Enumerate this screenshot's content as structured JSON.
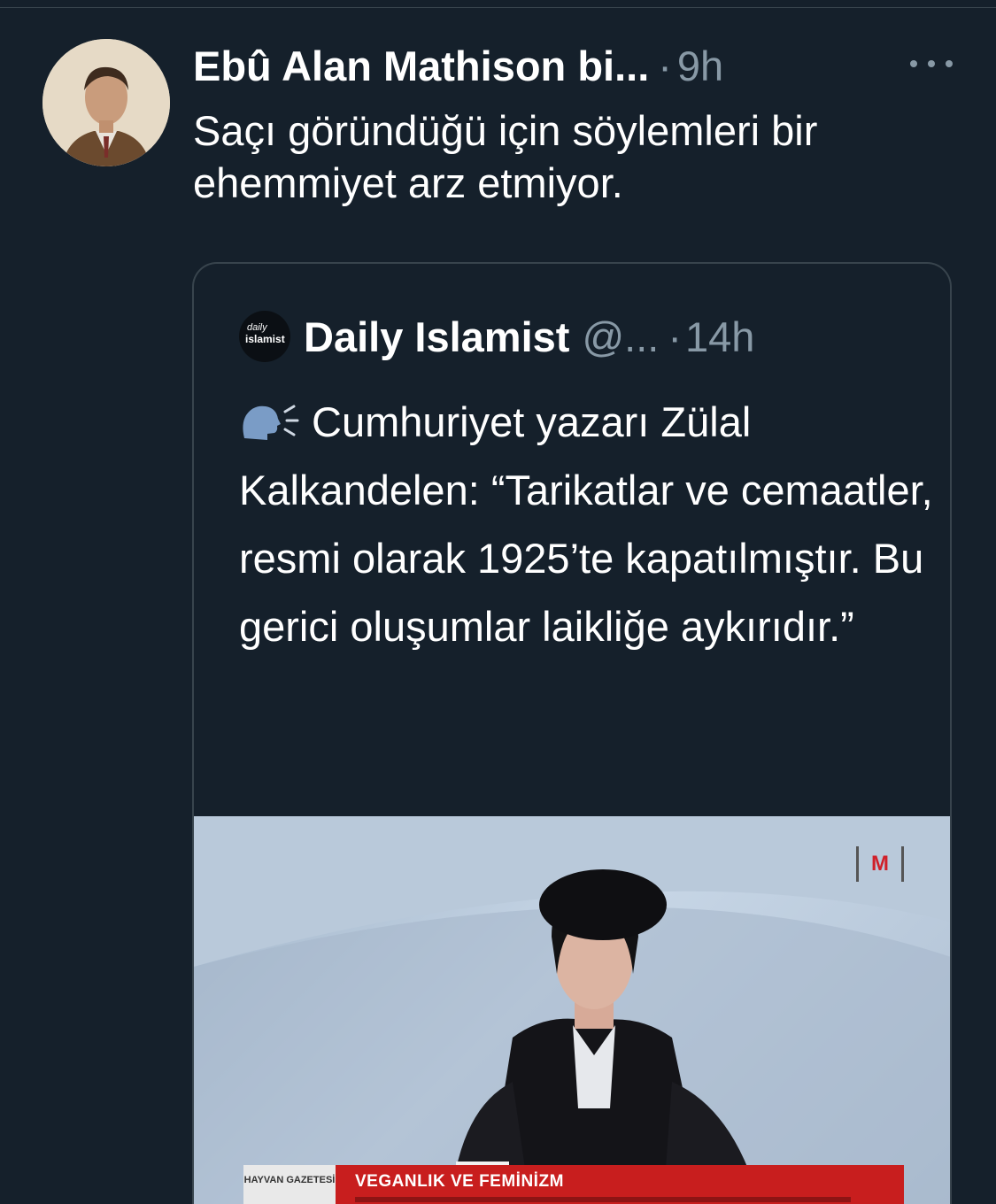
{
  "tweet": {
    "author": "Ebû Alan Mathison bi...",
    "separator": "·",
    "time": "9h",
    "text": "Saçı göründüğü için söylemleri bir ehemmiyet arz etmiyor."
  },
  "quoted_tweet": {
    "avatar_text_line1": "daily",
    "avatar_text_line2": "islamist",
    "author": "Daily Islamist",
    "handle": "@...",
    "separator": "·",
    "time": "14h",
    "icon": "speaking-head-icon",
    "text": "Cumhuriyet yazarı Zülal Kalkandelen: “Tarikatlar ve cemaatler, resmi olarak 1925’te kapatılmıştır. Bu gerici oluşumlar laikliğe aykırıdır.”",
    "media": {
      "channel_logo": "M",
      "lower_third_left": "HAYVAN GAZETESİ",
      "lower_third_title": "VEGANLIK VE FEMİNİZM"
    }
  },
  "colors": {
    "background": "#15202b",
    "secondary_text": "#8899a6",
    "border": "#38444d",
    "lower_third": "#c81e1e"
  }
}
